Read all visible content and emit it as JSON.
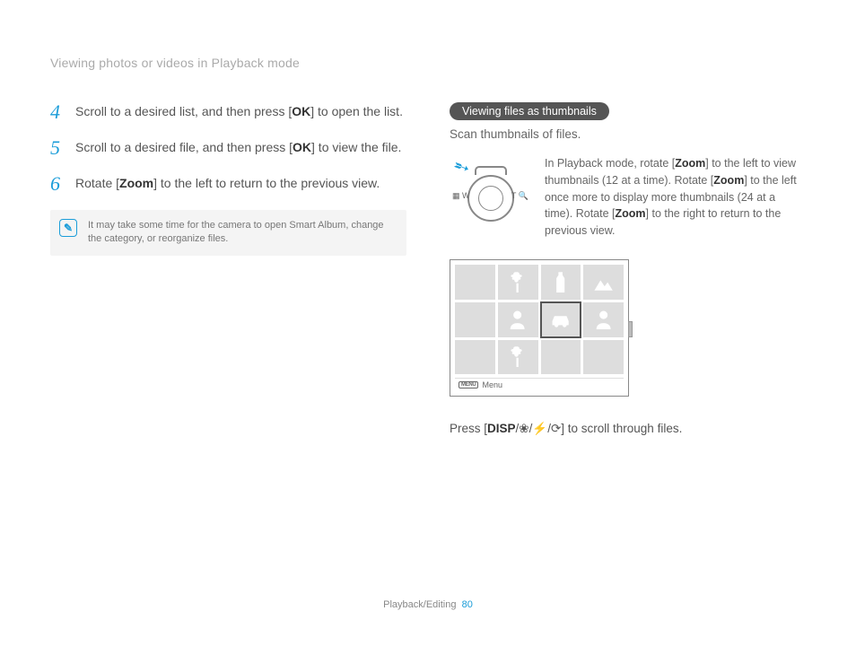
{
  "header": "Viewing photos or videos in Playback mode",
  "steps": [
    {
      "num": "4",
      "pre": "Scroll to a desired list, and then press [",
      "bold": "OK",
      "post": "] to open the list."
    },
    {
      "num": "5",
      "pre": "Scroll to a desired file, and then press [",
      "bold": "OK",
      "post": "] to view the file."
    },
    {
      "num": "6",
      "pre": "Rotate [",
      "bold": "Zoom",
      "post": "] to the left to return to the previous view."
    }
  ],
  "note": {
    "text": "It may take some time for the camera to open Smart Album, change the category, or reorganize files."
  },
  "right": {
    "pill": "Viewing files as thumbnails",
    "sub": "Scan thumbnails of files.",
    "zoom_desc": {
      "p1a": "In Playback mode, rotate [",
      "p1b": "Zoom",
      "p1c": "] to the left to view thumbnails (12 at a time). Rotate [",
      "p1d": "Zoom",
      "p1e": "] to the left once more to display more thumbnails (24 at a time). Rotate [",
      "p1f": "Zoom",
      "p1g": "] to the right to return to the previous view."
    },
    "labels": {
      "w": "W",
      "t": "T",
      "w_sym": "▦",
      "t_sym": "🔍"
    },
    "menu_label": "Menu",
    "menu_badge": "MENU",
    "bottom": {
      "pre": "Press [",
      "disp": "DISP",
      "mid": "/",
      "post": "] to scroll through files."
    }
  },
  "footer": {
    "section": "Playback/Editing",
    "page": "80"
  }
}
